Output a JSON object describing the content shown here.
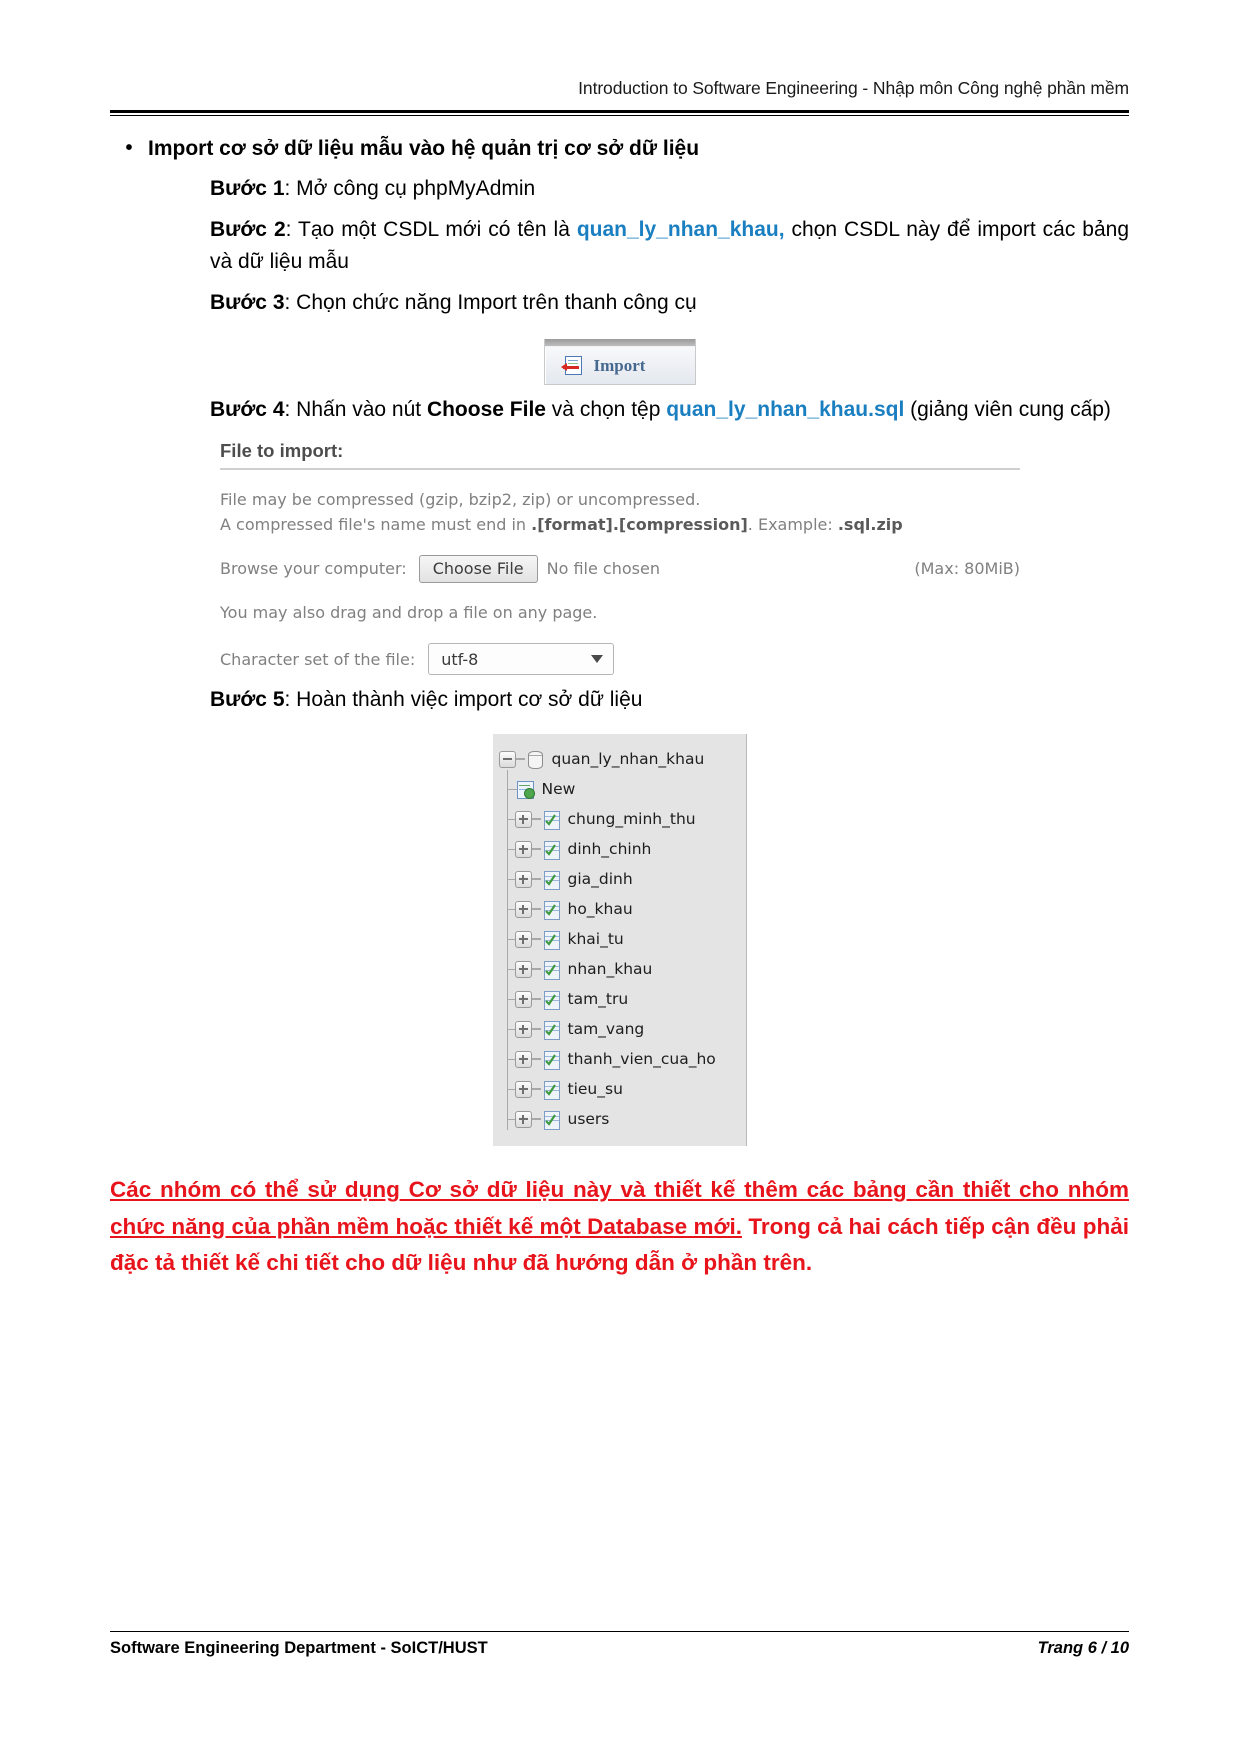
{
  "header": {
    "title": "Introduction to Software Engineering - Nhập môn Công nghệ phần mềm"
  },
  "accent_color": "#1a7fc1",
  "note_color": "#e8141b",
  "content": {
    "bullet": "Import cơ sở dữ liệu mẫu vào hệ quản trị cơ sở dữ liệu",
    "steps": [
      {
        "label": "Bước 1",
        "sep": ": ",
        "text": "Mở công cụ phpMyAdmin"
      },
      {
        "label": "Bước 2",
        "sep": ": ",
        "text_before": "Tạo một CSDL mới có tên là ",
        "accent": "quan_ly_nhan_khau,",
        "text_after": " chọn CSDL này để import các bảng và dữ liệu mẫu"
      },
      {
        "label": "Bước 3",
        "sep": ": ",
        "text": "Chọn chức năng Import trên thanh công cụ"
      },
      {
        "label": "Bước 4",
        "sep": ": ",
        "text_before": "Nhấn vào nút ",
        "bold_mid": "Choose File",
        "text_mid": " và chọn tệp ",
        "accent": "quan_ly_nhan_khau.sql",
        "text_after": " (giảng viên cung cấp)"
      },
      {
        "label": "Bước 5",
        "sep": ": ",
        "text": "Hoàn thành việc import cơ sở dữ liệu"
      }
    ],
    "note": {
      "underlined": "Các nhóm có thể sử dụng Cơ sở dữ liệu này và thiết kế thêm các bảng cần thiết cho nhóm chức năng của phần mềm hoặc thiết kế một Database mới.",
      "plain": " Trong cả hai cách tiếp cận đều phải đặc tả thiết kế chi tiết cho dữ liệu như đã hướng dẫn ở phần trên."
    }
  },
  "import_button": {
    "label": "Import",
    "icon": "import-icon"
  },
  "import_panel": {
    "title": "File to import:",
    "line1": "File may be compressed (gzip, bzip2, zip) or uncompressed.",
    "line2_before": "A compressed file's name must end in ",
    "line2_bold": ".[format].[compression]",
    "line2_after": ". Example: ",
    "line2_bold2": ".sql.zip",
    "browse_label": "Browse your computer:",
    "choose_file_button": "Choose File",
    "no_file_chosen": "No file chosen",
    "max_size": "(Max: 80MiB)",
    "dragdrop": "You may also drag and drop a file on any page.",
    "charset_label": "Character set of the file:",
    "charset_value": "utf-8"
  },
  "db_tree": {
    "database": "quan_ly_nhan_khau",
    "new_label": "New",
    "tables": [
      "chung_minh_thu",
      "dinh_chinh",
      "gia_dinh",
      "ho_khau",
      "khai_tu",
      "nhan_khau",
      "tam_tru",
      "tam_vang",
      "thanh_vien_cua_ho",
      "tieu_su",
      "users"
    ]
  },
  "footer": {
    "left": "Software Engineering Department - SoICT/HUST",
    "right": "Trang 6 / 10"
  }
}
